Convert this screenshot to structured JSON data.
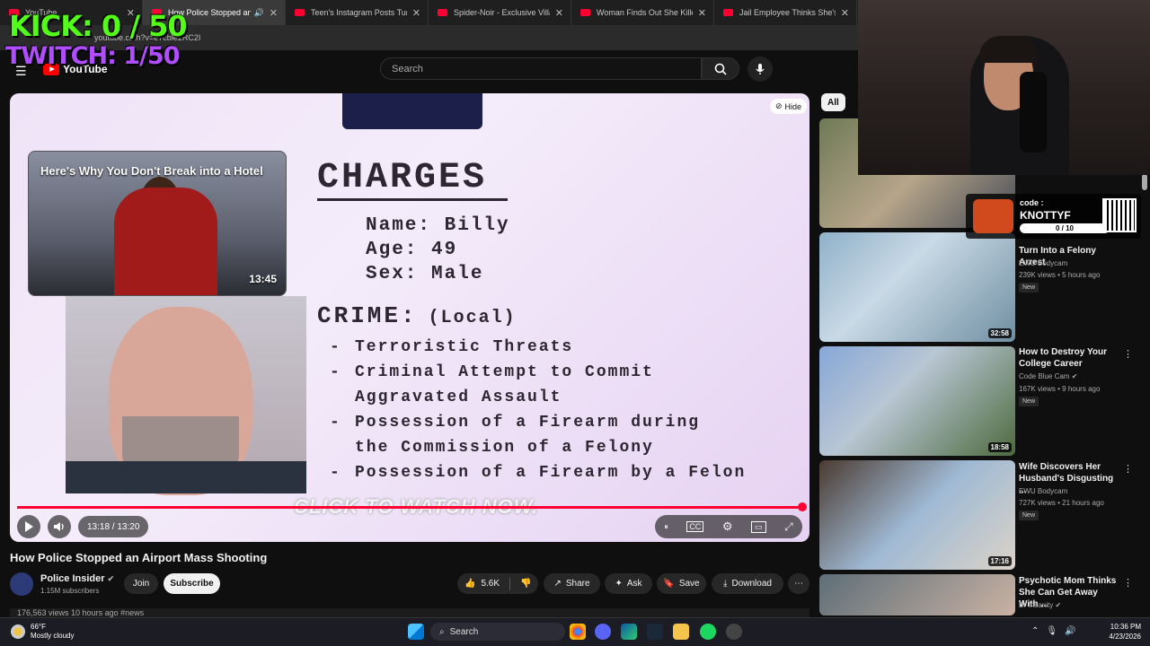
{
  "browser": {
    "tabs": [
      {
        "title": "YouTube"
      },
      {
        "title": "How Police Stopped an Airp"
      },
      {
        "title": "Teen's Instagram Posts Turn Int"
      },
      {
        "title": "Spider-Noir - Exclusive Villains"
      },
      {
        "title": "Woman Finds Out She Killed Hi"
      },
      {
        "title": "Jail Employee Thinks She's Abo"
      }
    ],
    "url": "youtube.c...h?v=e7cble2RC2I"
  },
  "overlay": {
    "kick": "KICK: 0 / 50",
    "twitch": "TWITCH: 1/50",
    "code_label": "code :",
    "code": "KNOTTYF",
    "code_progress": "0 / 10"
  },
  "header": {
    "logo": "YouTube",
    "search_placeholder": "Search"
  },
  "player": {
    "hide_label": "Hide",
    "card_title": "Here's Why You Don't Break into a Hotel",
    "card_duration": "13:45",
    "charges_title": "CHARGES",
    "info": [
      "Name: Billy",
      "Age: 49",
      "Sex: Male"
    ],
    "crime_title": "CRIME:",
    "crime_scope": "(Local)",
    "crimes": [
      "Terroristic Threats",
      "Criminal Attempt to Commit",
      "Aggravated Assault",
      "Possession of a Firearm during",
      "the Commission of a Felony",
      "Possession of a Firearm by a Felon"
    ],
    "cta": "CLICK TO WATCH NOW.",
    "time": "13:18 / 13:20",
    "progress": 0.99
  },
  "video": {
    "title": "How Police Stopped an Airport Mass Shooting",
    "channel": "Police Insider",
    "subscribers": "1.15M subscribers",
    "join": "Join",
    "subscribe": "Subscribe",
    "likes": "5.6K",
    "share": "Share",
    "ask": "Ask",
    "save": "Save",
    "download": "Download",
    "desc_line": "176,563 views  10 hours ago  #news"
  },
  "sidebar": {
    "chip": "All",
    "items": [
      {
        "title": "Turn Into a Felony Arrest",
        "channel": "EWU Bodycam",
        "meta": "239K views • 5 hours ago",
        "badge": "New",
        "duration": "32:58"
      },
      {
        "title": "How to Destroy Your College Career",
        "channel": "Code Blue Cam",
        "meta": "167K views • 9 hours ago",
        "badge": "New",
        "duration": "18:58"
      },
      {
        "title": "Wife Discovers Her Husband's Disgusting ...",
        "channel": "EWU Bodycam",
        "meta": "727K views • 21 hours ago",
        "badge": "New",
        "duration": "17:16"
      },
      {
        "title": "Psychotic Mom Thinks She Can Get Away With ...",
        "channel": "Dr Insanity",
        "meta": "",
        "badge": "",
        "duration": ""
      }
    ]
  },
  "taskbar": {
    "temp": "66°F",
    "weather": "Mostly cloudy",
    "search": "Search",
    "time": "10:36 PM",
    "date": "4/23/2026"
  }
}
